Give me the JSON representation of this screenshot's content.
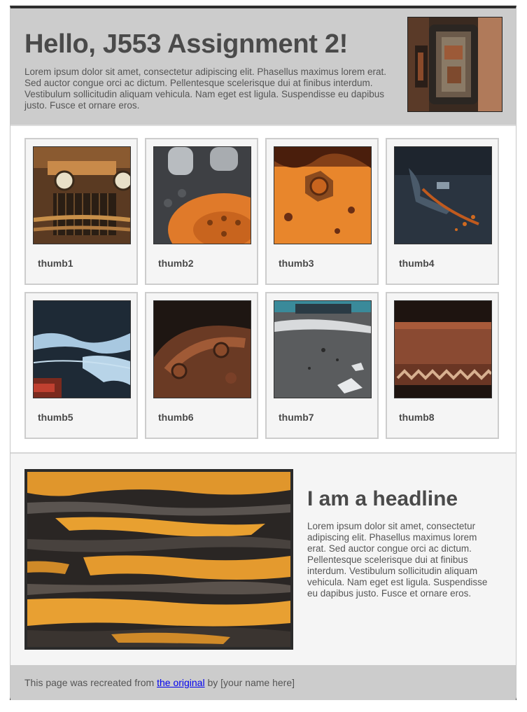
{
  "header": {
    "title": "Hello, J553 Assignment 2!",
    "intro": "Lorem ipsum dolor sit amet, consectetur adipiscing elit. Phasellus maximus lorem erat. Sed auctor congue orci ac dictum. Pellentesque scelerisque dui at finibus interdum. Vestibulum sollicitudin aliquam vehicula. Nam eget est ligula. Suspendisse eu dapibus justo. Fusce et ornare eros."
  },
  "gallery": {
    "items": [
      {
        "label": "thumb1"
      },
      {
        "label": "thumb2"
      },
      {
        "label": "thumb3"
      },
      {
        "label": "thumb4"
      },
      {
        "label": "thumb5"
      },
      {
        "label": "thumb6"
      },
      {
        "label": "thumb7"
      },
      {
        "label": "thumb8"
      }
    ]
  },
  "feature": {
    "headline": "I am a headline",
    "body": "Lorem ipsum dolor sit amet, consectetur adipiscing elit. Phasellus maximus lorem erat. Sed auctor congue orci ac dictum. Pellentesque scelerisque dui at finibus interdum. Vestibulum sollicitudin aliquam vehicula. Nam eget est ligula. Suspendisse eu dapibus justo. Fusce et ornare eros."
  },
  "footer": {
    "prefix": "This page was recreated from",
    "link_text": "the original",
    "suffix": "by [your name here]"
  },
  "colors": {
    "header_bg": "#cccccc",
    "card_bg": "#f5f5f5",
    "text": "#555555",
    "link": "#0000ee",
    "rust_orange": "#e08a2c"
  }
}
